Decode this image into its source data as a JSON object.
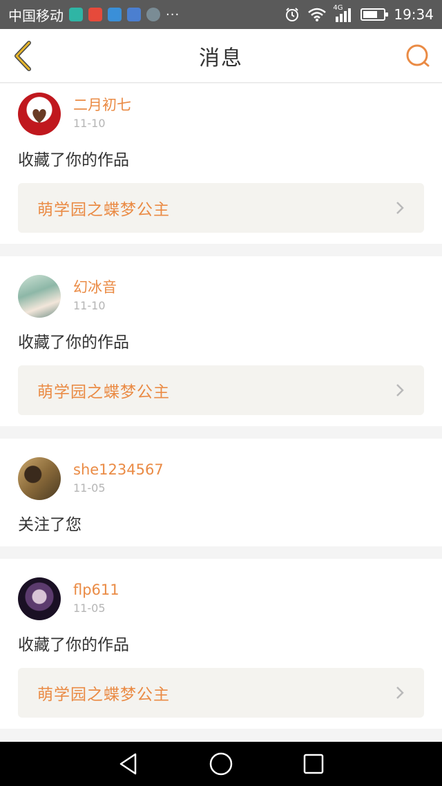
{
  "status": {
    "carrier": "中国移动",
    "dots": "···",
    "network": "4G",
    "time": "19:34"
  },
  "header": {
    "title": "消息"
  },
  "messages": [
    {
      "username": "二月初七",
      "date": "11-10",
      "action": "收藏了你的作品",
      "work": "萌学园之蝶梦公主"
    },
    {
      "username": "幻冰音",
      "date": "11-10",
      "action": "收藏了你的作品",
      "work": "萌学园之蝶梦公主"
    },
    {
      "username": "she1234567",
      "date": "11-05",
      "action": "关注了您",
      "work": ""
    },
    {
      "username": "flp611",
      "date": "11-05",
      "action": "收藏了你的作品",
      "work": "萌学园之蝶梦公主"
    }
  ],
  "colors": {
    "accent": "#ea8b45",
    "back_icon": "#d4a300",
    "date": "#b5b5b5"
  },
  "icons": {
    "back": "back-chevron-icon",
    "search": "search-icon",
    "nav_back": "triangle-back-icon",
    "nav_home": "circle-home-icon",
    "nav_recent": "square-recent-icon"
  }
}
